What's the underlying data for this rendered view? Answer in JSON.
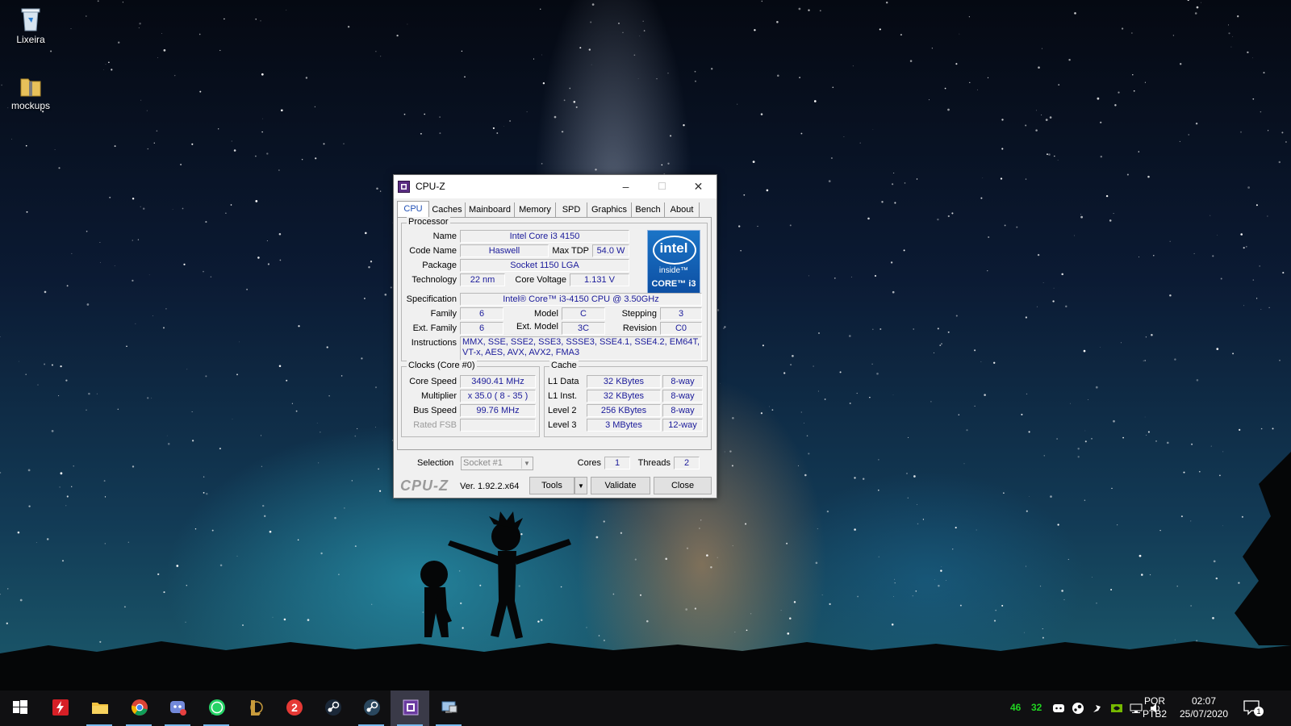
{
  "desktop": {
    "icons": [
      {
        "label": "Lixeira",
        "icon": "recycle-bin-icon"
      },
      {
        "label": "mockups",
        "icon": "folder-zip-icon"
      }
    ]
  },
  "window": {
    "title": "CPU-Z",
    "controls": {
      "minimize": "–",
      "maximize": "☐",
      "close": "✕"
    },
    "tabs": [
      "CPU",
      "Caches",
      "Mainboard",
      "Memory",
      "SPD",
      "Graphics",
      "Bench",
      "About"
    ],
    "active_tab": "CPU",
    "processor": {
      "group_label": "Processor",
      "name_label": "Name",
      "name": "Intel Core i3 4150",
      "code_name_label": "Code Name",
      "code_name": "Haswell",
      "max_tdp_label": "Max TDP",
      "max_tdp": "54.0 W",
      "package_label": "Package",
      "package": "Socket 1150 LGA",
      "technology_label": "Technology",
      "technology": "22 nm",
      "core_voltage_label": "Core Voltage",
      "core_voltage": "1.131 V",
      "specification_label": "Specification",
      "specification": "Intel® Core™ i3-4150 CPU @ 3.50GHz",
      "family_label": "Family",
      "family": "6",
      "model_label": "Model",
      "model": "C",
      "stepping_label": "Stepping",
      "stepping": "3",
      "ext_family_label": "Ext. Family",
      "ext_family": "6",
      "ext_model_label": "Ext. Model",
      "ext_model": "3C",
      "revision_label": "Revision",
      "revision": "C0",
      "instructions_label": "Instructions",
      "instructions": "MMX, SSE, SSE2, SSE3, SSSE3, SSE4.1, SSE4.2, EM64T, VT-x, AES, AVX, AVX2, FMA3"
    },
    "logo": {
      "brand": "intel",
      "inside": "inside™",
      "line": "CORE™ i3"
    },
    "clocks": {
      "group_label": "Clocks (Core #0)",
      "core_speed_label": "Core Speed",
      "core_speed": "3490.41 MHz",
      "multiplier_label": "Multiplier",
      "multiplier": "x 35.0 ( 8 - 35 )",
      "bus_speed_label": "Bus Speed",
      "bus_speed": "99.76 MHz",
      "rated_fsb_label": "Rated FSB",
      "rated_fsb": ""
    },
    "cache": {
      "group_label": "Cache",
      "rows": [
        {
          "label": "L1 Data",
          "size": "32 KBytes",
          "ways": "8-way"
        },
        {
          "label": "L1 Inst.",
          "size": "32 KBytes",
          "ways": "8-way"
        },
        {
          "label": "Level 2",
          "size": "256 KBytes",
          "ways": "8-way"
        },
        {
          "label": "Level 3",
          "size": "3 MBytes",
          "ways": "12-way"
        }
      ]
    },
    "selection": {
      "label": "Selection",
      "value": "Socket #1",
      "cores_label": "Cores",
      "cores": "1",
      "threads_label": "Threads",
      "threads": "2"
    },
    "footer": {
      "brand": "CPU-Z",
      "version": "Ver. 1.92.2.x64",
      "tools_label": "Tools",
      "validate_label": "Validate",
      "close_label": "Close"
    }
  },
  "taskbar": {
    "apps": [
      {
        "name": "start-button",
        "icon": "windows-logo-icon"
      },
      {
        "name": "bolt-app",
        "icon": "lightning-icon"
      },
      {
        "name": "file-explorer",
        "icon": "folder-icon"
      },
      {
        "name": "chrome",
        "icon": "chrome-icon"
      },
      {
        "name": "discord-ptb",
        "icon": "discord-icon"
      },
      {
        "name": "whatsapp",
        "icon": "whatsapp-icon"
      },
      {
        "name": "league-of-legends",
        "icon": "lol-icon"
      },
      {
        "name": "app-2",
        "icon": "number-2-icon"
      },
      {
        "name": "steam",
        "icon": "steam-icon"
      },
      {
        "name": "steam-2",
        "icon": "steam-icon"
      },
      {
        "name": "cpu-z",
        "icon": "cpu-z-icon"
      },
      {
        "name": "remote-desktop",
        "icon": "network-pc-icon"
      }
    ],
    "tray": {
      "temp_a": "46",
      "temp_b": "32",
      "icons": [
        "discord-tray-icon",
        "steam-tray-icon",
        "pin-tray-icon",
        "nvidia-tray-icon",
        "network-icon",
        "volume-icon"
      ],
      "lang": "POR",
      "layout": "PTB2",
      "time": "02:07",
      "date": "25/07/2020",
      "notifications": "1"
    }
  }
}
